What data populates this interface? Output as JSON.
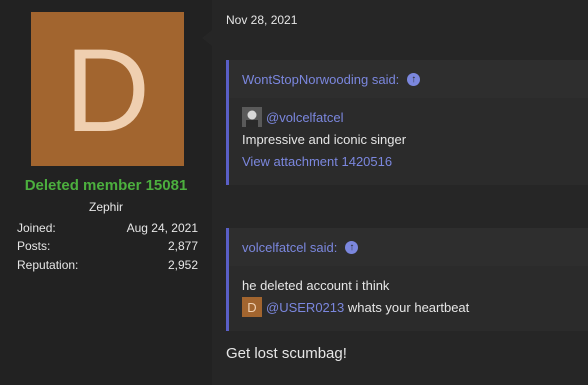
{
  "user": {
    "avatar_letter": "D",
    "avatar_color": "#a2652f",
    "name": "Deleted member 15081",
    "name_color": "#4caf3e",
    "title": "Zephir",
    "stats": [
      {
        "label": "Joined:",
        "value": "Aug 24, 2021"
      },
      {
        "label": "Posts:",
        "value": "2,877"
      },
      {
        "label": "Reputation:",
        "value": "2,952"
      }
    ]
  },
  "post": {
    "date": "Nov 28, 2021",
    "quotes": [
      {
        "author_line": "WontStopNorwooding said:",
        "mention": "@volcelfatcel",
        "text": "Impressive and iconic singer",
        "attachment": "View attachment 1420516"
      },
      {
        "author_line": "volcelfatcel said:",
        "text": "he deleted account i think",
        "mention": "@USER0213",
        "mention_suffix": " whats your heartbeat",
        "mini_avatar_letter": "D"
      }
    ],
    "reply": "Get lost scumbag!"
  },
  "colors": {
    "link": "#7b87de",
    "quote_border": "#5a5fc7"
  }
}
